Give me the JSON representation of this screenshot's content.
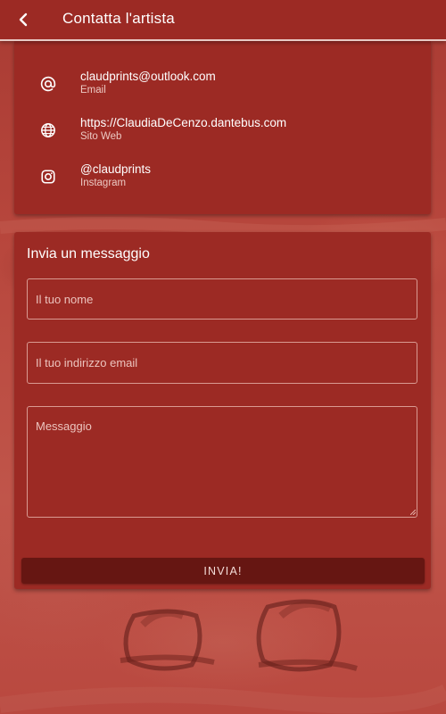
{
  "header": {
    "title": "Contatta l'artista",
    "back_icon": "chevron-left-icon"
  },
  "contacts": [
    {
      "icon": "at-icon",
      "value": "claudprints@outlook.com",
      "label": "Email"
    },
    {
      "icon": "globe-icon",
      "value": "https://ClaudiaDeCenzo.dantebus.com",
      "label": "Sito Web"
    },
    {
      "icon": "instagram-icon",
      "value": "@claudprints",
      "label": "Instagram"
    }
  ],
  "form": {
    "title": "Invia un messaggio",
    "name_placeholder": "Il tuo nome",
    "name_value": "",
    "email_placeholder": "Il tuo indirizzo email",
    "email_value": "",
    "message_placeholder": "Messaggio",
    "message_value": "",
    "submit_label": "INVIA!"
  },
  "colors": {
    "appbar": "#9c2a24",
    "card": "#9c2a24",
    "button": "#661612",
    "background": "#b4453b"
  }
}
